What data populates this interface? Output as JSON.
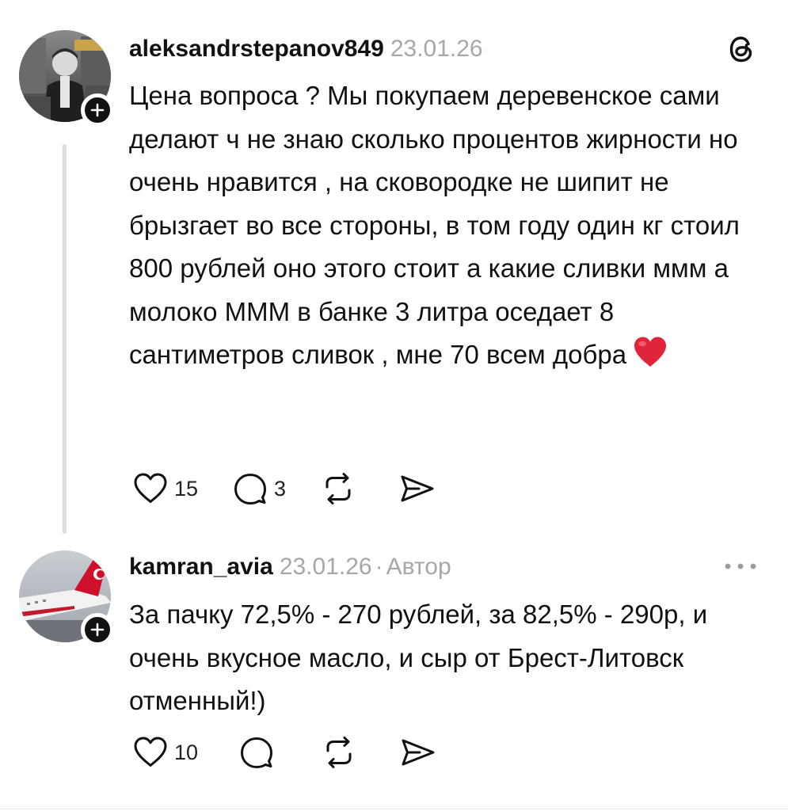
{
  "comments": [
    {
      "username": "aleksandrstepanov849",
      "date": "23.01.26",
      "text": "Цена вопроса ? Мы покупаем деревенское сами делают ч не знаю сколько процентов жирности но очень нравится , на сковородке не шипит не брызгает во все стороны, в том году один кг стоил 800 рублей оно этого стоит а какие сливки ммм а молоко МММ в банке 3 литра оседает 8 сантиметров сливок , мне 70 всем добра",
      "emoji": "red-heart",
      "likes": "15",
      "replies": "3",
      "corner_icon": "threads-logo-icon"
    },
    {
      "username": "kamran_avia",
      "date": "23.01.26",
      "separator": "·",
      "author_tag": "Автор",
      "text": "За пачку 72,5% - 270 рублей, за 82,5% - 290р, и очень вкусное масло, и сыр от Брест-Литовск отменный!)",
      "likes": "10",
      "corner_icon": "more-options-icon"
    }
  ],
  "icons": {
    "like": "heart-outline-icon",
    "reply": "speech-bubble-icon",
    "repost": "repost-icon",
    "share": "send-arrow-icon",
    "follow": "plus-icon"
  },
  "colors": {
    "text": "#111111",
    "muted": "#a7a7a7",
    "thread_line": "#dedede",
    "heart_emoji": "#e0243a"
  }
}
